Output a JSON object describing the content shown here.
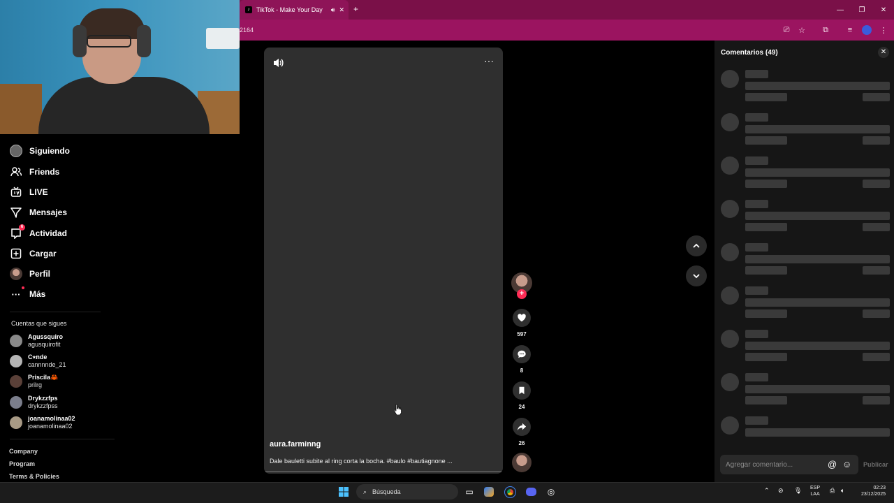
{
  "browser": {
    "tab_title": "TikTok - Make Your Day",
    "address_fragment": "2164",
    "theme_color": "#9b1460"
  },
  "sidebar": {
    "items": [
      {
        "label": "Siguiendo",
        "icon": "following-avatar-icon"
      },
      {
        "label": "Friends",
        "icon": "friends-icon"
      },
      {
        "label": "LIVE",
        "icon": "live-icon"
      },
      {
        "label": "Mensajes",
        "icon": "messages-icon"
      },
      {
        "label": "Actividad",
        "icon": "activity-icon",
        "badge": "6"
      },
      {
        "label": "Cargar",
        "icon": "upload-icon"
      },
      {
        "label": "Perfil",
        "icon": "profile-avatar-icon"
      },
      {
        "label": "Más",
        "icon": "more-icon"
      }
    ],
    "following_title": "Cuentas que sigues",
    "accounts": [
      {
        "name": "Agussquiro",
        "username": "agusquirofit"
      },
      {
        "name": "C⭑nde",
        "username": "cannnnde_21"
      },
      {
        "name": "Priscila🦀",
        "username": "prilrg"
      },
      {
        "name": "Drykzzfps",
        "username": "drykzzfpss"
      },
      {
        "name": "joanamolinaa02",
        "username": "joanamolinaa02"
      }
    ],
    "footer_links": [
      "Company",
      "Program",
      "Terms & Policies"
    ]
  },
  "video": {
    "creator": "aura.farminng",
    "caption": "Dale bauletti subite al ring corta la bocha. #baulo #bautiagnone ...",
    "likes": "597",
    "comments": "8",
    "saves": "24",
    "shares": "26"
  },
  "comments_panel": {
    "title": "Comentarios (49)",
    "placeholder": "Agregar comentario...",
    "publish_label": "Publicar"
  },
  "taskbar": {
    "search_label": "Búsqueda",
    "lang": "ESP",
    "lang_sub": "LAA",
    "time": "02:23",
    "date": "23/12/2025"
  }
}
